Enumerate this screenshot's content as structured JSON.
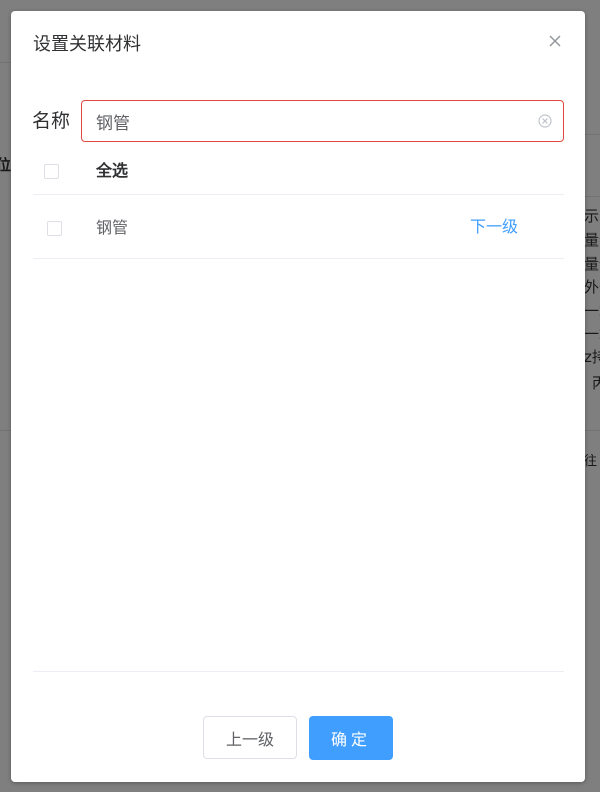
{
  "background": {
    "left_text": "位",
    "right_fragments": [
      "示",
      "量分",
      "量值",
      "外省",
      "一端",
      "一端",
      "z持",
      "丙",
      "往"
    ]
  },
  "dialog": {
    "title": "设置关联材料",
    "close_icon": "close-icon"
  },
  "search": {
    "label": "名称",
    "value": "钢管",
    "placeholder": "",
    "clear_icon": "circle-close-icon"
  },
  "table": {
    "header": {
      "select_all_label": "全选"
    },
    "rows": [
      {
        "name": "钢管",
        "action": "下一级"
      }
    ]
  },
  "footer": {
    "prev_label": "上一级",
    "confirm_label": "确定"
  },
  "colors": {
    "accent": "#409eff",
    "error_border": "#e1483f"
  }
}
